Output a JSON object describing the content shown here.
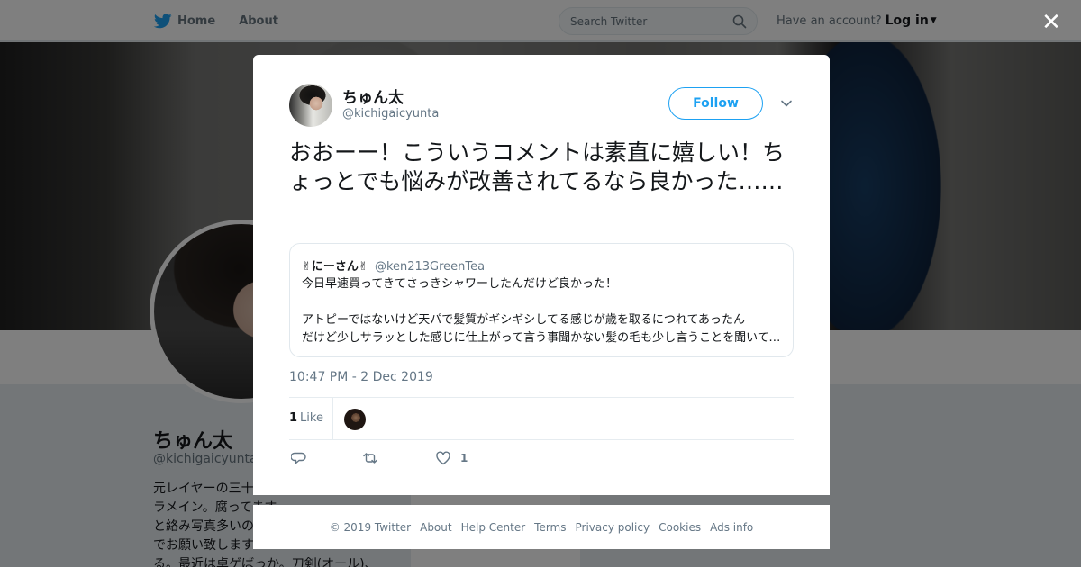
{
  "nav": {
    "home_label": "Home",
    "about_label": "About",
    "search_placeholder": "Search Twitter",
    "account_prompt": "Have an account?",
    "login_label": "Log in"
  },
  "background_profile": {
    "name": "ちゅん太",
    "handle": "@kichigaicyunta",
    "bio_lines": [
      "元レイヤーの三十",
      "ラメイン。腐ってます",
      "と絡み写真多いの",
      "でお願い致します",
      "る。最近は卓ゲばっか。刀剣(オール)、"
    ]
  },
  "tweet": {
    "author_name": "ちゅん太",
    "author_handle": "@kichigaicyunta",
    "follow_label": "Follow",
    "text": "おおーー！こういうコメントは素直に嬉しい！ちょっとでも悩みが改善されてるなら良かった……",
    "quoted": {
      "name": "✌にーさん✌",
      "handle": "@ken213GreenTea",
      "line1": "今日早速買ってきてさっきシャワーしたんだけど良かった！",
      "line2": "アトピーではないけど天パで髪質がギシギシしてる感じが歳を取るにつれてあったん",
      "line3": "だけど少しサラッとした感じに仕上がって言う事聞かない髪の毛も少し言うことを聞いてくれるようになった"
    },
    "timestamp": "10:47 PM - 2 Dec 2019",
    "like_count": "1",
    "like_label": "Like",
    "action_like_count": "1"
  },
  "footer": {
    "links": [
      "© 2019 Twitter",
      "About",
      "Help Center",
      "Terms",
      "Privacy policy",
      "Cookies",
      "Ads info"
    ]
  },
  "colors": {
    "accent": "#1da1f2",
    "secondary_text": "#657786",
    "border": "#e1e8ed"
  },
  "icons": [
    "twitter-bird-icon",
    "home-icon",
    "search-icon",
    "caret-down-icon",
    "close-icon",
    "chevron-down-icon",
    "reply-icon",
    "retweet-icon",
    "heart-icon"
  ]
}
